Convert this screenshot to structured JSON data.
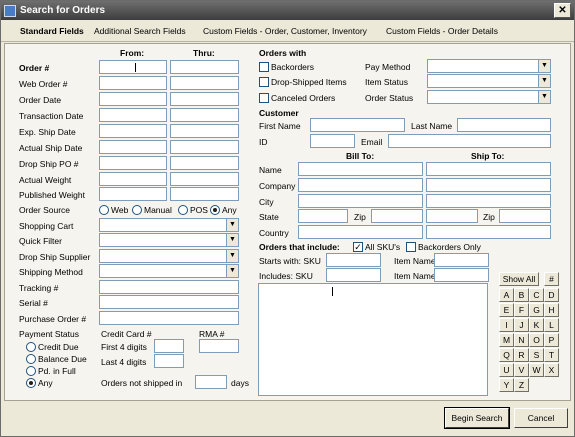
{
  "window": {
    "title": "Search for Orders",
    "close_glyph": "✕"
  },
  "tabs": [
    {
      "label": "Standard Fields"
    },
    {
      "label": "Additional Search Fields"
    },
    {
      "label": "Custom Fields - Order, Customer, Inventory"
    },
    {
      "label": "Custom Fields - Order Details"
    }
  ],
  "left": {
    "from_label": "From:",
    "thru_label": "Thru:",
    "range_fields": [
      {
        "label": "Order #"
      },
      {
        "label": "Web Order #"
      },
      {
        "label": "Order Date"
      },
      {
        "label": "Transaction Date"
      },
      {
        "label": "Exp. Ship Date"
      },
      {
        "label": "Actual Ship Date"
      },
      {
        "label": "Drop Ship PO #"
      },
      {
        "label": "Actual Weight"
      },
      {
        "label": "Published Weight"
      }
    ],
    "order_source": {
      "label": "Order Source",
      "options": [
        "Web",
        "Manual",
        "POS",
        "Any"
      ],
      "selected": "Any"
    },
    "dropdowns": [
      {
        "label": "Shopping Cart"
      },
      {
        "label": "Quick Filter"
      },
      {
        "label": "Drop Ship Supplier"
      },
      {
        "label": "Shipping Method"
      }
    ],
    "text_fields": [
      {
        "label": "Tracking #"
      },
      {
        "label": "Serial #"
      },
      {
        "label": "Purchase Order #"
      }
    ],
    "payment_status": {
      "label": "Payment Status",
      "options": [
        "Credit Due",
        "Balance Due",
        "Pd. in Full",
        "Any"
      ],
      "selected": "Any"
    },
    "credit_card": {
      "label": "Credit Card #",
      "first4": "First 4 digits",
      "last4": "Last 4 digits"
    },
    "rma_label": "RMA #",
    "not_shipped": {
      "label": "Orders not shipped in",
      "unit": "days"
    }
  },
  "right": {
    "orders_with": {
      "heading": "Orders with",
      "checks": [
        "Backorders",
        "Drop-Shipped Items",
        "Canceled Orders"
      ],
      "dropdowns": [
        "Pay Method",
        "Item Status",
        "Order Status"
      ]
    },
    "customer": {
      "heading": "Customer",
      "first_name": "First Name",
      "last_name": "Last Name",
      "id": "ID",
      "email": "Email"
    },
    "address": {
      "bill_to": "Bill To:",
      "ship_to": "Ship To:",
      "rows": [
        "Name",
        "Company",
        "City",
        "State",
        "Country"
      ],
      "zip": "Zip"
    },
    "include": {
      "heading": "Orders that include:",
      "all_skus": "All SKU's",
      "all_skus_checked": true,
      "backorders_only": "Backorders Only",
      "starts_with": "Starts with: SKU",
      "includes": "Includes: SKU",
      "item_name": "Item Name"
    },
    "alpha": {
      "show_all": "Show All",
      "hash": "#",
      "letters": [
        "A",
        "B",
        "C",
        "D",
        "E",
        "F",
        "G",
        "H",
        "I",
        "J",
        "K",
        "L",
        "M",
        "N",
        "O",
        "P",
        "Q",
        "R",
        "S",
        "T",
        "U",
        "V",
        "W",
        "X",
        "Y",
        "Z"
      ]
    }
  },
  "footer": {
    "search": "Begin Search",
    "cancel": "Cancel"
  }
}
